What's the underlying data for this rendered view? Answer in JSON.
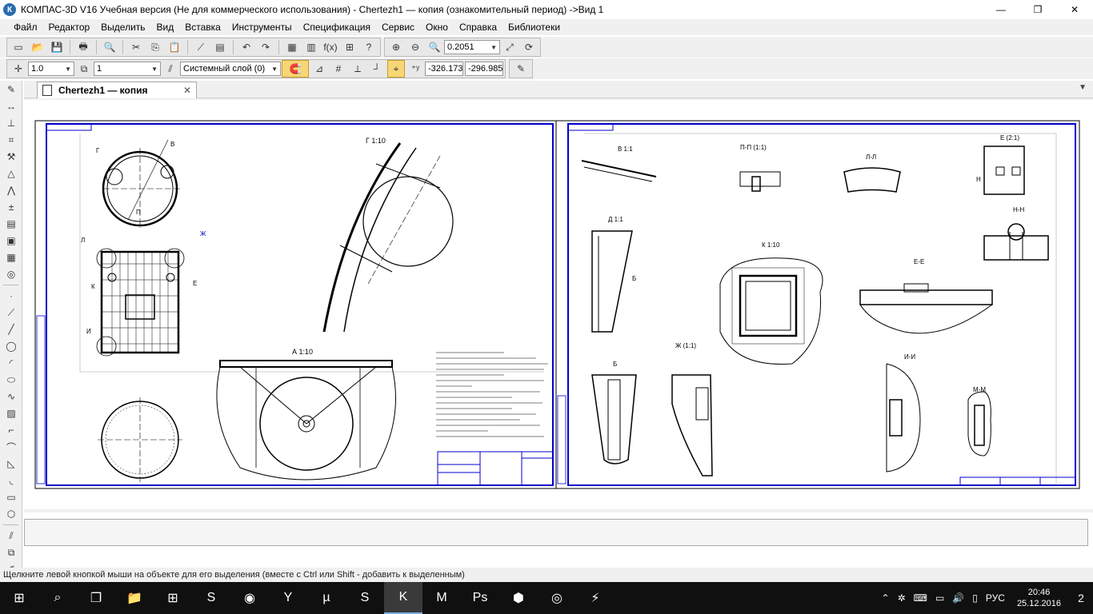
{
  "window": {
    "title": "КОМПАС-3D V16 Учебная версия  (Не для коммерческого использования) - Chertezh1 — копия (ознакомительный период) ->Вид 1",
    "app_icon": "К",
    "minimize": "—",
    "maximize": "❐",
    "close": "✕"
  },
  "menu": [
    "Файл",
    "Редактор",
    "Выделить",
    "Вид",
    "Вставка",
    "Инструменты",
    "Спецификация",
    "Сервис",
    "Окно",
    "Справка",
    "Библиотеки"
  ],
  "toolbar1": {
    "zoom_value": "0.2051"
  },
  "toolbar2": {
    "line_scale": "1.0",
    "step": "1",
    "layer": "Системный слой (0)",
    "coord_x": "-326.173",
    "coord_y": "-296.985"
  },
  "document": {
    "tab_title": "Chertezh1 — копия",
    "tab_close": "✕"
  },
  "drawing": {
    "view_labels": [
      "Г 1:10",
      "В 1:1",
      "П-П (1:1)",
      "Л-Л",
      "Е (2:1)",
      "Д 1:1",
      "К 1:10",
      "Е-Е",
      "Н-Н",
      "А 1:10",
      "Ж (1:1)",
      "Б",
      "И-И",
      "М-М"
    ],
    "marks": [
      "Г",
      "В",
      "П",
      "Л",
      "Ж",
      "К",
      "Е",
      "И",
      "Б",
      "А",
      "Н",
      "М"
    ]
  },
  "hint": "Щелкните левой кнопкой мыши на объекте для его выделения (вместе с Ctrl или Shift - добавить к выделенным)",
  "tray": {
    "language": "РУС",
    "time": "20:46",
    "date": "25.12.2016",
    "notifications": "2"
  }
}
